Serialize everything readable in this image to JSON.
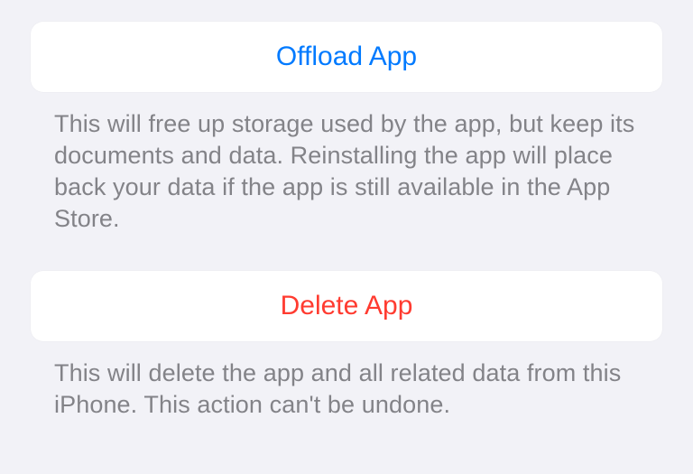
{
  "offload": {
    "button_label": "Offload App",
    "description": "This will free up storage used by the app, but keep its documents and data. Reinstalling the app will place back your data if the app is still available in the App Store."
  },
  "delete": {
    "button_label": "Delete App",
    "description": "This will delete the app and all related data from this iPhone. This action can't be undone."
  }
}
